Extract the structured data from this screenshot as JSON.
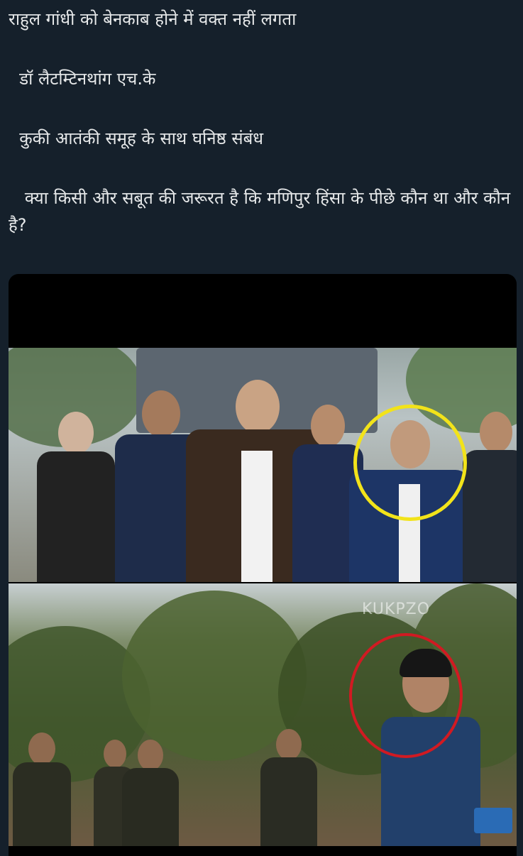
{
  "tweet": {
    "lines": [
      "राहुल गांधी को बेनकाब होने में वक्त नहीं लगता",
      "  डॉ लैटम्टिनथांग एच.के",
      "  कुकी आतंकी समूह के साथ घनिष्ठ संबंध",
      "   क्या किसी और सबूत की जरूरत है कि मणिपुर हिंसा के पीछे कौन था और कौन है?"
    ]
  },
  "media": {
    "watermark": "KUKPZO"
  },
  "colors": {
    "background": "#15202b",
    "text": "#e7e9ea",
    "highlight_top": "#f2e31a",
    "highlight_bottom": "#d11a22"
  }
}
